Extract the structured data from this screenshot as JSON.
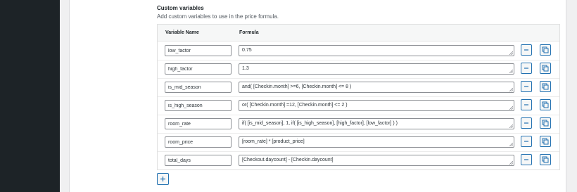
{
  "section": {
    "title": "Custom variables",
    "description": "Add custom variables to use in the price formula."
  },
  "table": {
    "headers": {
      "name": "Variable Name",
      "formula": "Formula"
    },
    "rows": [
      {
        "name": "low_factor",
        "formula": "0.75"
      },
      {
        "name": "high_factor",
        "formula": "1.3"
      },
      {
        "name": "is_mid_season",
        "formula": "and( [Checkin.month] >=6, [Checkin.month] <= 8 )"
      },
      {
        "name": "is_high_season",
        "formula": "or( [Checkin.month] =12, [Checkin.month] <= 2 )"
      },
      {
        "name": "room_rate",
        "formula": "if( [is_mid_season], 1, if( [is_high_season], [high_factor], [low_factor] ) )"
      },
      {
        "name": "room_price",
        "formula": "[room_rate] * [product_price]"
      },
      {
        "name": "total_days",
        "formula": "[Checkout.daycount] - [Checkin.daycount]"
      }
    ]
  },
  "icons": {
    "remove": "minus-icon",
    "duplicate": "copy-icon",
    "add": "plus-icon",
    "resize": "resize-grip-icon"
  },
  "colors": {
    "accent": "#2271b1",
    "sidebar": "#1d2327"
  }
}
